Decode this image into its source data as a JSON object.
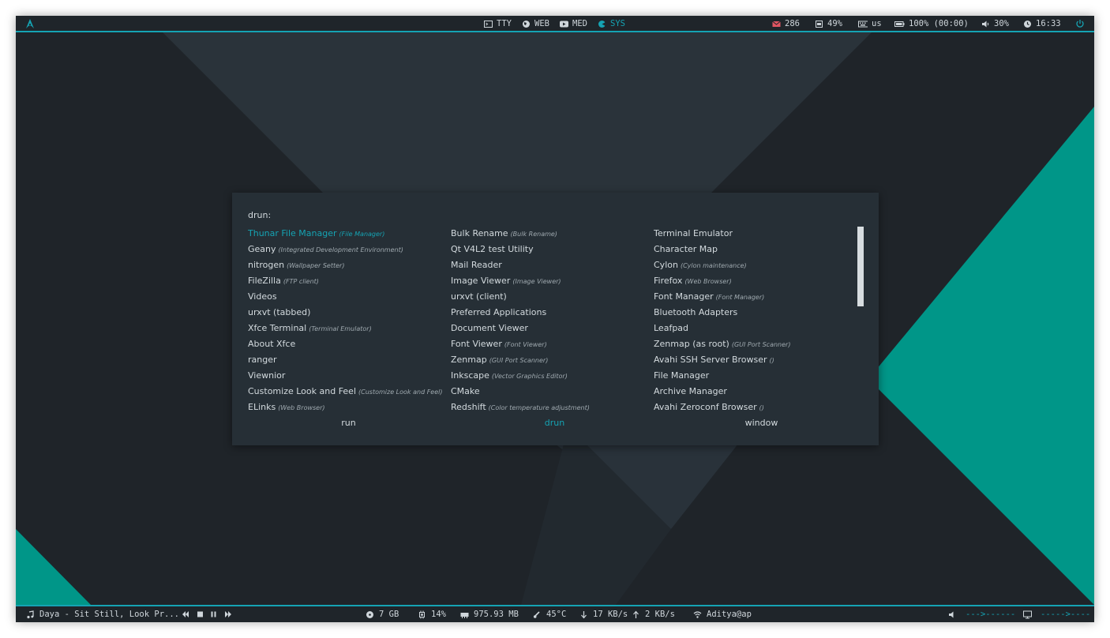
{
  "colors": {
    "accent": "#15a3b3",
    "bar_bg": "#1f252a",
    "panel_bg": "#262f36",
    "wall_teal": "#009688",
    "mail_icon": "#e05561"
  },
  "topbar": {
    "logo_icon": "arch-icon",
    "workspaces": [
      {
        "icon": "terminal-icon",
        "label": "TTY"
      },
      {
        "icon": "globe-icon",
        "label": "WEB"
      },
      {
        "icon": "play-icon",
        "label": "MED"
      },
      {
        "icon": "settings-icon",
        "label": "SYS"
      }
    ],
    "active_workspace": "SYS",
    "mail": "286",
    "memory": "49%",
    "keyboard": "us",
    "battery": "100% (00:00)",
    "volume": "30%",
    "clock": "16:33",
    "power_icon": "power-icon"
  },
  "rofi": {
    "prompt": "drun:",
    "columns": [
      [
        {
          "name": "Thunar File Manager",
          "generic": "(File Manager)"
        },
        {
          "name": "Geany",
          "generic": "(Integrated Development Environment)"
        },
        {
          "name": "nitrogen",
          "generic": "(Wallpaper Setter)"
        },
        {
          "name": "FileZilla",
          "generic": "(FTP client)"
        },
        {
          "name": "Videos",
          "generic": ""
        },
        {
          "name": "urxvt (tabbed)",
          "generic": ""
        },
        {
          "name": "Xfce Terminal",
          "generic": "(Terminal Emulator)"
        },
        {
          "name": "About Xfce",
          "generic": ""
        },
        {
          "name": "ranger",
          "generic": ""
        },
        {
          "name": "Viewnior",
          "generic": ""
        },
        {
          "name": "Customize Look and Feel",
          "generic": "(Customize Look and Feel)"
        },
        {
          "name": "ELinks",
          "generic": "(Web Browser)"
        }
      ],
      [
        {
          "name": "Bulk Rename",
          "generic": "(Bulk Rename)"
        },
        {
          "name": "Qt V4L2 test Utility",
          "generic": ""
        },
        {
          "name": "Mail Reader",
          "generic": ""
        },
        {
          "name": "Image Viewer",
          "generic": "(Image Viewer)"
        },
        {
          "name": "urxvt (client)",
          "generic": ""
        },
        {
          "name": "Preferred Applications",
          "generic": ""
        },
        {
          "name": "Document Viewer",
          "generic": ""
        },
        {
          "name": "Font Viewer",
          "generic": "(Font Viewer)"
        },
        {
          "name": "Zenmap",
          "generic": "(GUI Port Scanner)"
        },
        {
          "name": "Inkscape",
          "generic": "(Vector Graphics Editor)"
        },
        {
          "name": "CMake",
          "generic": ""
        },
        {
          "name": "Redshift",
          "generic": "(Color temperature adjustment)"
        }
      ],
      [
        {
          "name": "Terminal Emulator",
          "generic": ""
        },
        {
          "name": "Character Map",
          "generic": ""
        },
        {
          "name": "Cylon",
          "generic": "(Cylon maintenance)"
        },
        {
          "name": "Firefox",
          "generic": "(Web Browser)"
        },
        {
          "name": "Font Manager",
          "generic": "(Font Manager)"
        },
        {
          "name": "Bluetooth Adapters",
          "generic": ""
        },
        {
          "name": "Leafpad",
          "generic": ""
        },
        {
          "name": "Zenmap (as root)",
          "generic": "(GUI Port Scanner)"
        },
        {
          "name": "Avahi SSH Server Browser",
          "generic": "()"
        },
        {
          "name": "File Manager",
          "generic": ""
        },
        {
          "name": "Archive Manager",
          "generic": ""
        },
        {
          "name": "Avahi Zeroconf Browser",
          "generic": "()"
        }
      ]
    ],
    "selected": "Thunar File Manager",
    "modes": [
      "run",
      "drun",
      "window"
    ],
    "active_mode": "drun"
  },
  "bottombar": {
    "music": "Daya - Sit Still, Look Pr...",
    "player_controls": [
      "previous-icon",
      "stop-icon",
      "pause-icon",
      "next-icon"
    ],
    "disk": "7 GB",
    "cpu": "14%",
    "ram": "975.93 MB",
    "temp": "45°C",
    "down": "17 KB/s",
    "up": "2 KB/s",
    "network": "Aditya@ap",
    "volume_bar": "--->------",
    "brightness_bar": "----->----"
  }
}
